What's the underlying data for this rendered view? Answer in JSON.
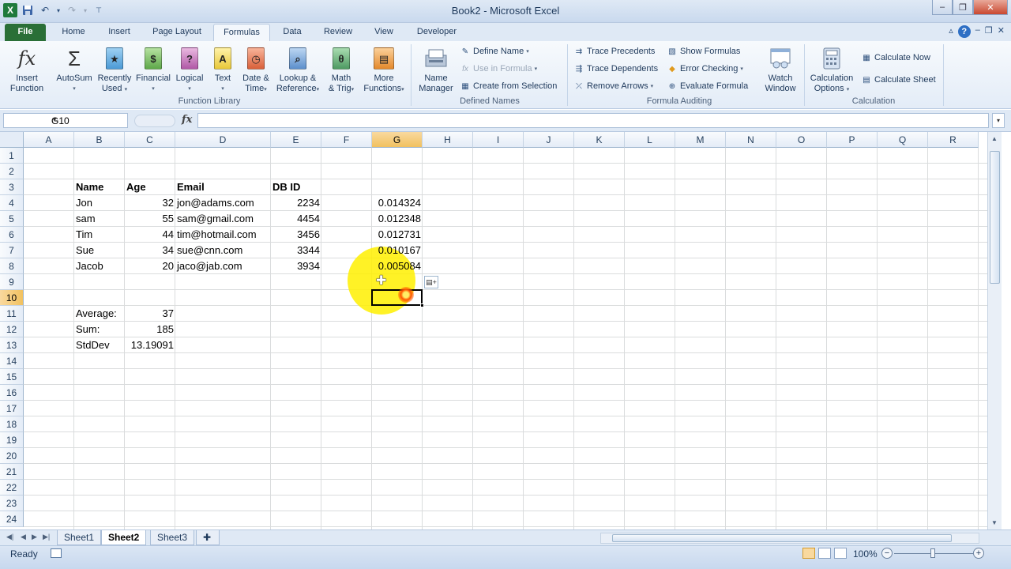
{
  "window": {
    "title": "Book2 - Microsoft Excel",
    "controls": {
      "minimize": "–",
      "restore": "❐",
      "close": "✕"
    }
  },
  "ribbon_tabs": [
    "File",
    "Home",
    "Insert",
    "Page Layout",
    "Formulas",
    "Data",
    "Review",
    "View",
    "Developer"
  ],
  "ribbon": {
    "function_library": {
      "label": "Function Library",
      "insert_function": [
        "Insert",
        "Function"
      ],
      "autosum": [
        "AutoSum",
        ""
      ],
      "recently_used": [
        "Recently",
        "Used"
      ],
      "financial": [
        "Financial",
        ""
      ],
      "logical": [
        "Logical",
        ""
      ],
      "text": [
        "Text",
        ""
      ],
      "date_time": [
        "Date &",
        "Time"
      ],
      "lookup": [
        "Lookup &",
        "Reference"
      ],
      "math": [
        "Math",
        "& Trig"
      ],
      "more": [
        "More",
        "Functions"
      ]
    },
    "defined_names": {
      "label": "Defined Names",
      "name_manager": [
        "Name",
        "Manager"
      ],
      "define_name": "Define Name",
      "use_in_formula": "Use in Formula",
      "create_from_selection": "Create from Selection"
    },
    "formula_auditing": {
      "label": "Formula Auditing",
      "trace_precedents": "Trace Precedents",
      "trace_dependents": "Trace Dependents",
      "remove_arrows": "Remove Arrows",
      "show_formulas": "Show Formulas",
      "error_checking": "Error Checking",
      "evaluate_formula": "Evaluate Formula",
      "watch_window": [
        "Watch",
        "Window"
      ]
    },
    "calculation": {
      "label": "Calculation",
      "calculation_options": [
        "Calculation",
        "Options"
      ],
      "calculate_now": "Calculate Now",
      "calculate_sheet": "Calculate Sheet"
    }
  },
  "formula_bar": {
    "name_box": "G10",
    "fx": "fx",
    "value": ""
  },
  "columns": [
    "A",
    "B",
    "C",
    "D",
    "E",
    "F",
    "G",
    "H",
    "I",
    "J",
    "K",
    "L",
    "M",
    "N",
    "O",
    "P",
    "Q",
    "R"
  ],
  "rows": [
    "1",
    "2",
    "3",
    "4",
    "5",
    "6",
    "7",
    "8",
    "9",
    "10",
    "11",
    "12",
    "13",
    "14",
    "15",
    "16",
    "17",
    "18",
    "19",
    "20",
    "21",
    "22",
    "23",
    "24"
  ],
  "selected_cell": "G10",
  "cells": {
    "header": {
      "name": "Name",
      "age": "Age",
      "email": "Email",
      "dbid": "DB ID"
    },
    "people": [
      {
        "name": "Jon",
        "age": "32",
        "email": "jon@adams.com",
        "dbid": "2234",
        "g": "0.014324"
      },
      {
        "name": "sam",
        "age": "55",
        "email": "sam@gmail.com",
        "dbid": "4454",
        "g": "0.012348"
      },
      {
        "name": "Tim",
        "age": "44",
        "email": "tim@hotmail.com",
        "dbid": "3456",
        "g": "0.012731"
      },
      {
        "name": "Sue",
        "age": "34",
        "email": "sue@cnn.com",
        "dbid": "3344",
        "g": "0.010167"
      },
      {
        "name": "Jacob",
        "age": "20",
        "email": "jaco@jab.com",
        "dbid": "3934",
        "g": "0.005084"
      }
    ],
    "stats": [
      {
        "label": "Average:",
        "value": "37"
      },
      {
        "label": "Sum:",
        "value": "185"
      },
      {
        "label": "StdDev",
        "value": "13.19091"
      }
    ]
  },
  "sheets": [
    "Sheet1",
    "Sheet2",
    "Sheet3"
  ],
  "active_sheet": "Sheet2",
  "status": {
    "mode": "Ready",
    "zoom": "100%"
  },
  "icons": [
    "excel-logo-icon",
    "save-icon",
    "undo-icon",
    "redo-icon",
    "fx-icon",
    "sigma-icon",
    "help-icon"
  ]
}
